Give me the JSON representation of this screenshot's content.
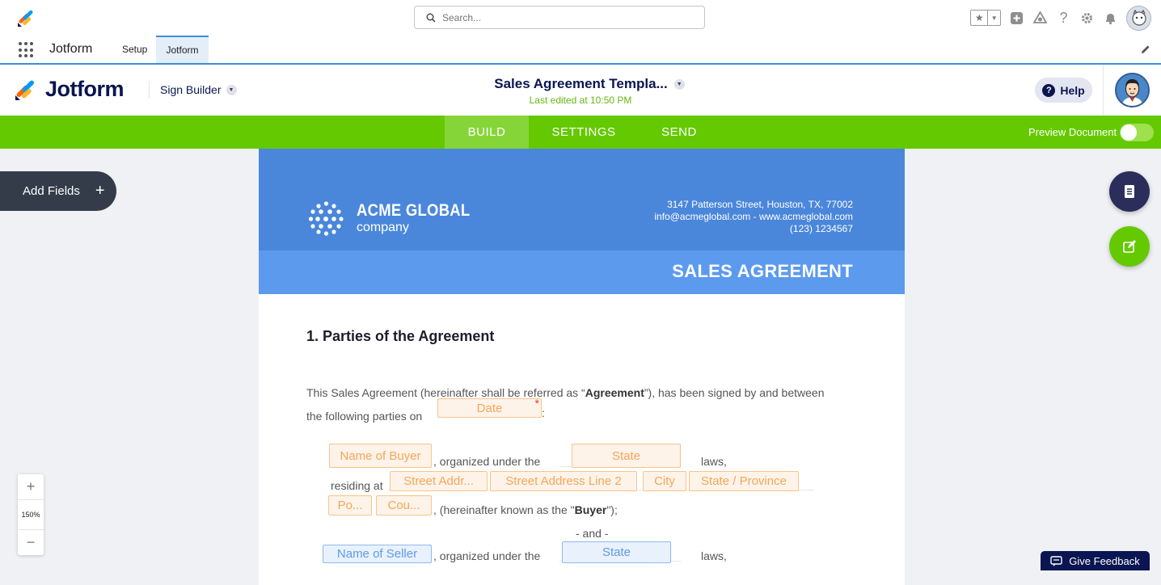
{
  "topbar": {
    "search_placeholder": "Search..."
  },
  "tabs": {
    "app_name": "Jotform",
    "items": [
      {
        "label": "Setup",
        "active": false
      },
      {
        "label": "Jotform",
        "active": true
      }
    ]
  },
  "header": {
    "brand": "Jotform",
    "builder_label": "Sign Builder",
    "document_title": "Sales Agreement Templa...",
    "last_edited": "Last edited at 10:50 PM",
    "help_label": "Help"
  },
  "nav": {
    "tabs": [
      {
        "label": "BUILD",
        "active": true
      },
      {
        "label": "SETTINGS",
        "active": false
      },
      {
        "label": "SEND",
        "active": false
      }
    ],
    "preview_label": "Preview Document",
    "preview_enabled": false
  },
  "left_panel": {
    "add_fields_label": "Add Fields",
    "zoom_level": "150%"
  },
  "feedback_label": "Give Feedback",
  "document": {
    "company_line1": "ACME GLOBAL",
    "company_line2": "company",
    "address": "3147 Patterson Street, Houston, TX, 77002",
    "contact": "info@acmeglobal.com - www.acmeglobal.com",
    "phone": "(123) 1234567",
    "banner_title": "SALES AGREEMENT",
    "section_title": "1. Parties of the Agreement",
    "intro_1": "This Sales Agreement (hereinafter shall be referred as “",
    "intro_bold": "Agreement",
    "intro_2": "”), has been signed by and between",
    "intro_3": "the following parties on",
    "colon": ":",
    "organized_under": ", organized under the",
    "laws": "laws,",
    "residing_at": "residing at",
    "buyer_known_1": ", (hereinafter known as the \"",
    "buyer_known_bold": "Buyer",
    "buyer_known_2": "\");",
    "and": "- and -",
    "fields": {
      "date": "Date",
      "name_of_buyer": "Name of Buyer",
      "buyer_state": "State",
      "street_addr": "Street Addr...",
      "street_line2": "Street Address Line 2",
      "city": "City",
      "state_province": "State / Province",
      "postal": "Po...",
      "country": "Cou...",
      "name_of_seller": "Name of Seller",
      "seller_state": "State"
    }
  },
  "colors": {
    "navy": "#0a1551",
    "green": "#64c900",
    "doc_blue": "#4a87db",
    "field_orange": "#f5a65b",
    "field_blue": "#5f9be3"
  }
}
